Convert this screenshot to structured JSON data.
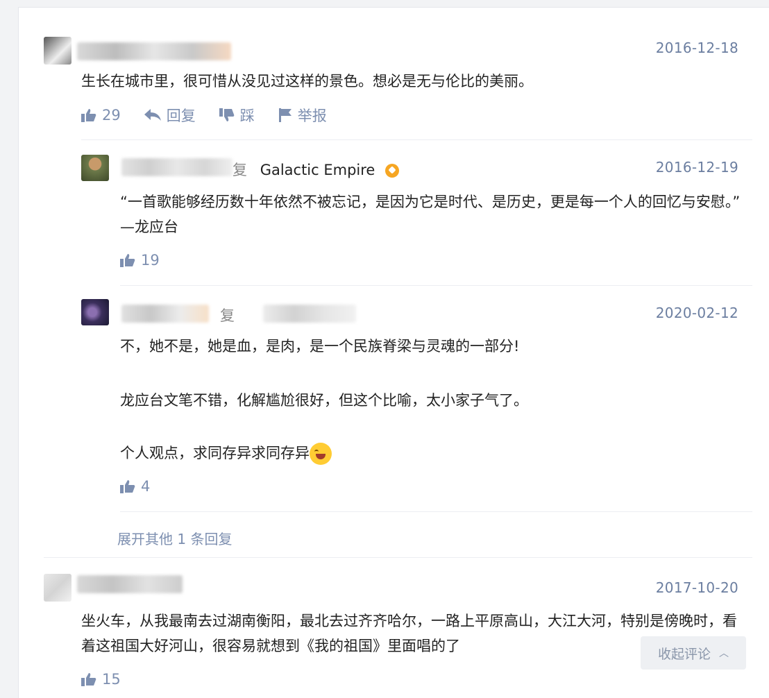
{
  "comments": [
    {
      "date": "2016-12-18",
      "text": "生长在城市里，很可惜从没见过这样的景色。想必是无与伦比的美丽。",
      "likes": "29",
      "reply_label": "回复",
      "dislike_label": "踩",
      "report_label": "举报"
    },
    {
      "author_tail": "复",
      "reply_to": "Galactic Empire",
      "date": "2016-12-19",
      "text": "“一首歌能够经历数十年依然不被忘记，是因为它是时代、是历史，更是每一个人的回忆与安慰。” —龙应台",
      "likes": "19"
    },
    {
      "author_tail": "复",
      "date": "2020-02-12",
      "paragraphs": [
        "不，她不是，她是血，是肉，是一个民族脊梁与灵魂的一部分!",
        "龙应台文笔不错，化解尴尬很好，但这个比喻，太小家子气了。",
        "个人观点，求同存异求同存异"
      ],
      "likes": "4"
    },
    {
      "date": "2017-10-20",
      "text": "坐火车，从我最南去过湖南衡阳，最北去过齐齐哈尔，一路上平原高山，大江大河，特别是傍晚时，看着这祖国大好河山，很容易就想到《我的祖国》里面唱的了",
      "likes": "15"
    }
  ],
  "more_replies": "展开其他 1 条回复",
  "collapse_label": "收起评论",
  "icons": [
    "thumb-up-icon",
    "reply-arrow-icon",
    "thumb-down-icon",
    "flag-icon",
    "chevron-up-icon",
    "badge-icon",
    "grin-emoji-icon"
  ],
  "colors": {
    "meta": "#7d8fb0",
    "date": "#6b7ea0",
    "badge": "#f6a623"
  }
}
